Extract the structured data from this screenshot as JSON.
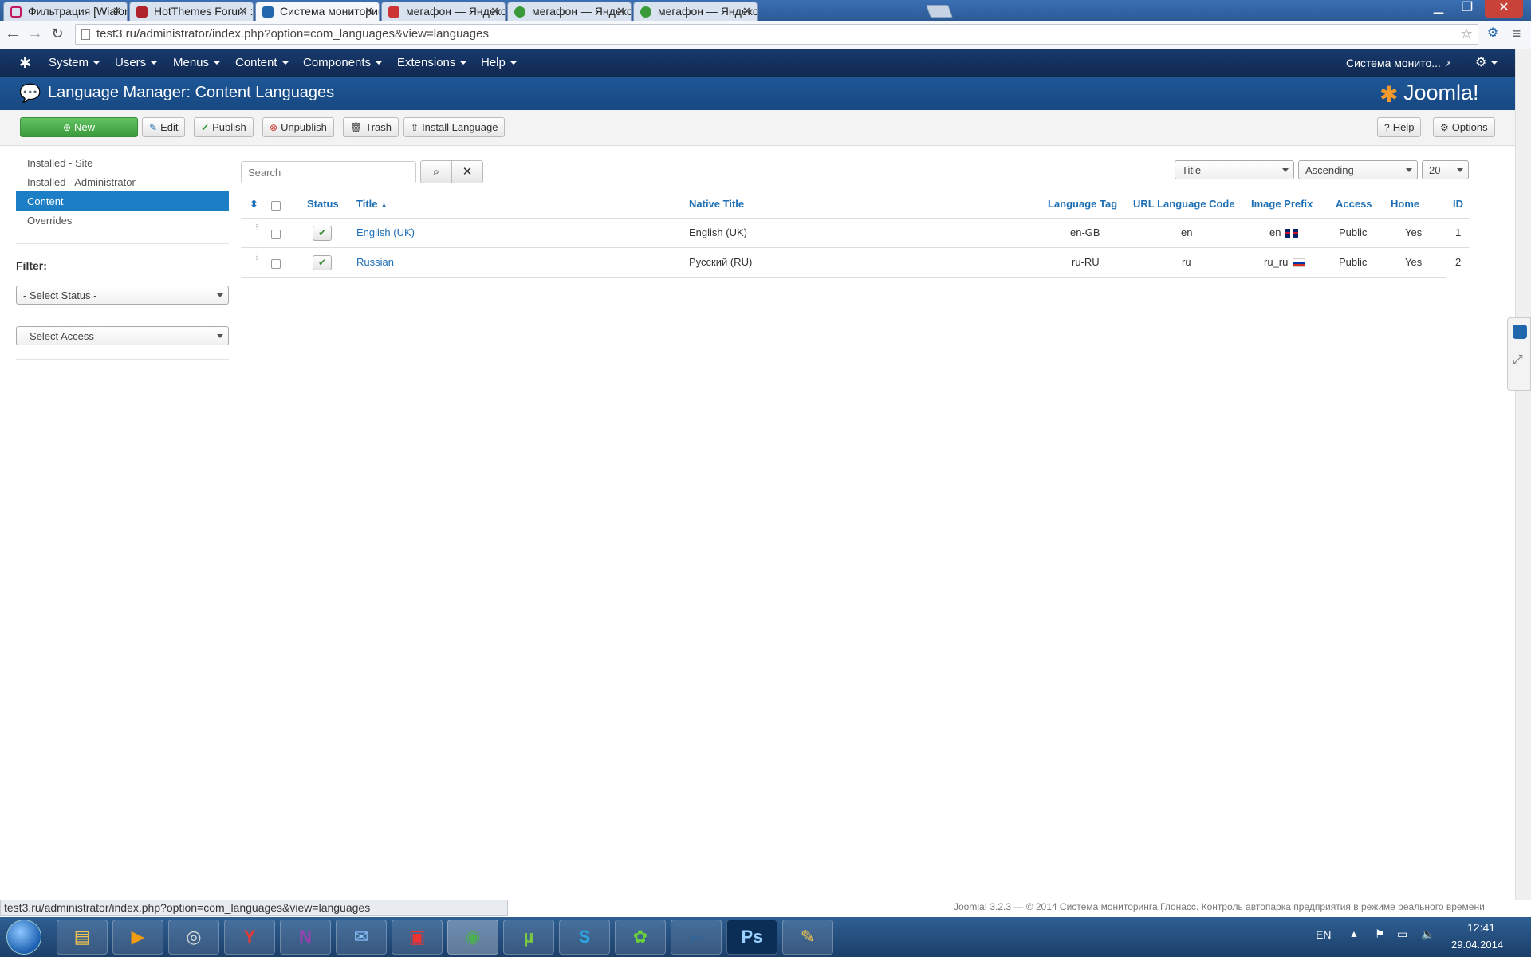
{
  "browser": {
    "tabs": [
      {
        "title": "Фильтрация [Wialon",
        "color": "#c2185b"
      },
      {
        "title": "HotThemes Forum ::",
        "color": "#b0232a"
      },
      {
        "title": "Система мониторин",
        "color": "#1f66ad"
      },
      {
        "title": "мегафон — Яндекс:",
        "color": "#cc3333"
      },
      {
        "title": "мегафон — Яндекс:",
        "color": "#3a9a3a"
      },
      {
        "title": "мегафон — Яндекс:",
        "color": "#3a9a3a"
      }
    ],
    "url": "test3.ru/administrator/index.php?option=com_languages&view=languages",
    "status_url": "test3.ru/administrator/index.php?option=com_languages&view=languages"
  },
  "navbar": {
    "items": [
      "System",
      "Users",
      "Menus",
      "Content",
      "Components",
      "Extensions",
      "Help"
    ],
    "site_link": "Система монито...",
    "brand_icon": "joomla-icon",
    "settings_icon": "gear-icon"
  },
  "header": {
    "title": "Language Manager: Content Languages",
    "logo_text": "Joomla!"
  },
  "toolbar": {
    "new": "New",
    "edit": "Edit",
    "publish": "Publish",
    "unpublish": "Unpublish",
    "trash": "Trash",
    "install": "Install Language",
    "help": "Help",
    "options": "Options"
  },
  "sidebar": {
    "items": [
      "Installed - Site",
      "Installed - Administrator",
      "Content",
      "Overrides"
    ],
    "active_index": 2,
    "filter_label": "Filter:",
    "select_status": "- Select Status -",
    "select_access": "- Select Access -"
  },
  "search": {
    "placeholder": "Search"
  },
  "list_controls": {
    "sort_field": "Title",
    "sort_dir": "Ascending",
    "limit": "20"
  },
  "table": {
    "headers": {
      "status": "Status",
      "title": "Title",
      "native_title": "Native Title",
      "language_tag": "Language Tag",
      "url_code": "URL Language Code",
      "image_prefix": "Image Prefix",
      "access": "Access",
      "home": "Home",
      "id": "ID"
    },
    "rows": [
      {
        "title": "English (UK)",
        "native": "English (UK)",
        "tag": "en-GB",
        "code": "en",
        "prefix": "en",
        "access": "Public",
        "home": "Yes",
        "id": "1"
      },
      {
        "title": "Russian",
        "native": "Русский (RU)",
        "tag": "ru-RU",
        "code": "ru",
        "prefix": "ru_ru",
        "access": "Public",
        "home": "Yes",
        "id": "2"
      }
    ]
  },
  "footer": {
    "text": "Joomla! 3.2.3 — © 2014 Система мониторинга Глонасс. Контроль автопарка предприятия в режиме реального времени"
  },
  "taskbar": {
    "language": "EN",
    "time": "12:41",
    "date": "29.04.2014"
  },
  "colors": {
    "navbar": "#183a6e",
    "title_bar": "#1e5797",
    "accent": "#1c7ec5",
    "link": "#1d6fb5",
    "success": "#3a9a3a"
  }
}
